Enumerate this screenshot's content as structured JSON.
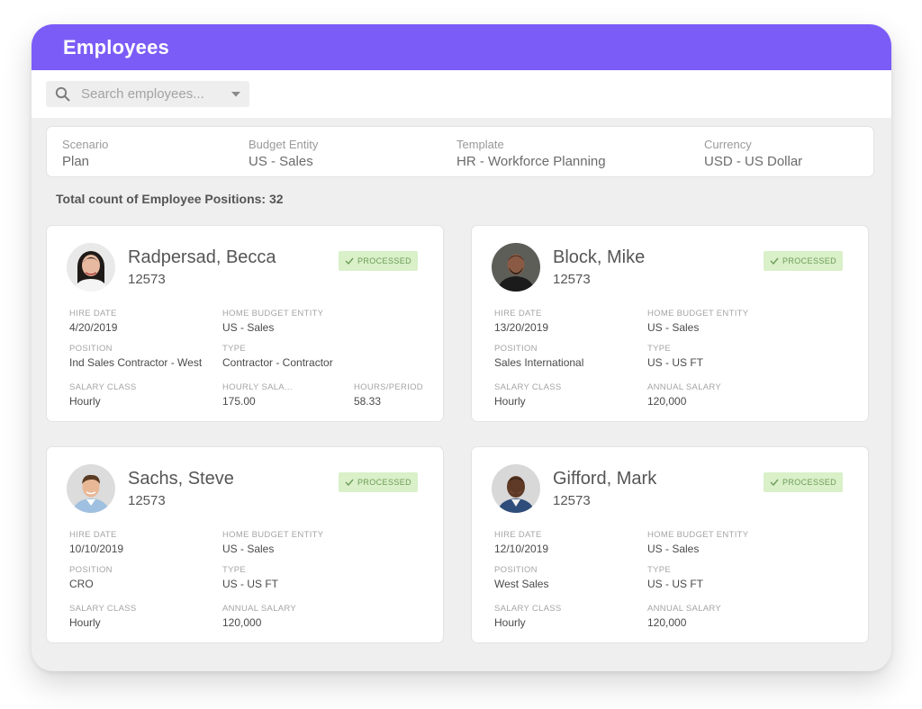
{
  "app": {
    "title": "Employees"
  },
  "search": {
    "placeholder": "Search employees..."
  },
  "filters": [
    {
      "label": "Scenario",
      "value": "Plan"
    },
    {
      "label": "Budget Entity",
      "value": "US - Sales"
    },
    {
      "label": "Template",
      "value": "HR - Workforce Planning"
    },
    {
      "label": "Currency",
      "value": "USD - US Dollar"
    }
  ],
  "summary": {
    "total_text": "Total count of Employee Positions: 32"
  },
  "colors": {
    "brand": "#7b5cf7",
    "badge_bg": "#d9f0c8",
    "badge_text": "#6e9c5a"
  },
  "employees": [
    {
      "name": "Radpersad, Becca",
      "id": "12573",
      "status": "PROCESSED",
      "avatar_icon": "avatar-woman-icon",
      "hire_date_label": "HIRE DATE",
      "hire_date": "4/20/2019",
      "budget_label": "HOME BUDGET ENTITY",
      "budget": "US - Sales",
      "position_label": "POSITION",
      "position": "Ind Sales Contractor - West",
      "type_label": "TYPE",
      "type": "Contractor - Contractor",
      "class_label": "SALARY CLASS",
      "class": "Hourly",
      "salary_label": "HOURLY SALA...",
      "salary": "175.00",
      "extra_label": "HOURS/PERIOD",
      "extra": "58.33"
    },
    {
      "name": "Block, Mike",
      "id": "12573",
      "status": "PROCESSED",
      "avatar_icon": "avatar-man-icon",
      "hire_date_label": "HIRE DATE",
      "hire_date": "13/20/2019",
      "budget_label": "HOME BUDGET ENTITY",
      "budget": "US - Sales",
      "position_label": "POSITION",
      "position": "Sales International",
      "type_label": "TYPE",
      "type": "US - US FT",
      "class_label": "SALARY CLASS",
      "class": "Hourly",
      "salary_label": "ANNUAL SALARY",
      "salary": "120,000"
    },
    {
      "name": "Sachs, Steve",
      "id": "12573",
      "status": "PROCESSED",
      "avatar_icon": "avatar-man-icon",
      "hire_date_label": "HIRE DATE",
      "hire_date": "10/10/2019",
      "budget_label": "HOME BUDGET ENTITY",
      "budget": "US - Sales",
      "position_label": "POSITION",
      "position": "CRO",
      "type_label": "TYPE",
      "type": "US - US FT",
      "class_label": "SALARY CLASS",
      "class": "Hourly",
      "salary_label": "ANNUAL SALARY",
      "salary": "120,000"
    },
    {
      "name": "Gifford, Mark",
      "id": "12573",
      "status": "PROCESSED",
      "avatar_icon": "avatar-man-icon",
      "hire_date_label": "HIRE DATE",
      "hire_date": "12/10/2019",
      "budget_label": "HOME BUDGET ENTITY",
      "budget": "US - Sales",
      "position_label": "POSITION",
      "position": "West Sales",
      "type_label": "TYPE",
      "type": "US - US FT",
      "class_label": "SALARY CLASS",
      "class": "Hourly",
      "salary_label": "ANNUAL SALARY",
      "salary": "120,000"
    }
  ]
}
